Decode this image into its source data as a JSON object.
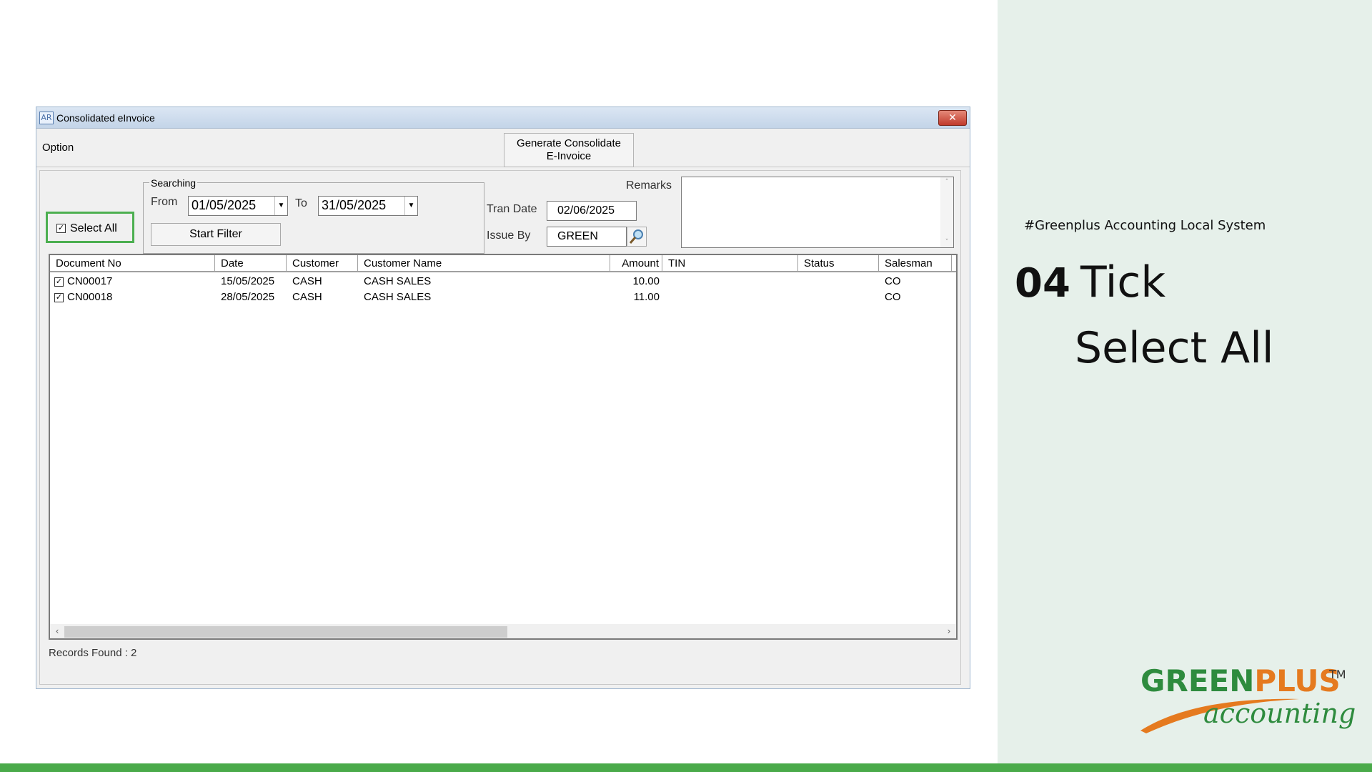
{
  "window": {
    "app_icon": "AR",
    "title": "Consolidated eInvoice",
    "close_label": "✕"
  },
  "menubar": {
    "option_label": "Option",
    "generate_label_line1": "Generate Consolidate",
    "generate_label_line2": "E-Invoice"
  },
  "filters": {
    "select_all_label": "Select All",
    "select_all_checked": true,
    "searching_label": "Searching",
    "from_label": "From",
    "from_value": "01/05/2025",
    "to_label": "To",
    "to_value": "31/05/2025",
    "start_filter_label": "Start Filter",
    "tran_date_label": "Tran Date",
    "tran_date_value": "02/06/2025",
    "issue_by_label": "Issue By",
    "issue_by_value": "GREEN",
    "remarks_label": "Remarks",
    "remarks_value": ""
  },
  "grid": {
    "columns": [
      "Document No",
      "Date",
      "Customer",
      "Customer Name",
      "Amount",
      "TIN",
      "Status",
      "Salesman"
    ],
    "rows": [
      {
        "checked": true,
        "doc_no": "CN00017",
        "date": "15/05/2025",
        "customer": "CASH",
        "customer_name": "CASH SALES",
        "amount": "10.00",
        "tin": "",
        "status": "",
        "salesman": "CO"
      },
      {
        "checked": true,
        "doc_no": "CN00018",
        "date": "28/05/2025",
        "customer": "CASH",
        "customer_name": "CASH SALES",
        "amount": "11.00",
        "tin": "",
        "status": "",
        "salesman": "CO"
      }
    ],
    "records_found": "Records Found : 2"
  },
  "side": {
    "hashtag": "#Greenplus Accounting Local System",
    "step_number": "04",
    "step_word": "Tick",
    "step_line2": "Select All"
  },
  "logo": {
    "green_part": "GREEN",
    "plus_part": "PLUS",
    "tm": "TM",
    "tagline": "accounting"
  },
  "colors": {
    "highlight": "#4caf50",
    "brand_green": "#2e8b3e",
    "brand_orange": "#e57a1f",
    "side_panel": "#e6f0ea"
  }
}
